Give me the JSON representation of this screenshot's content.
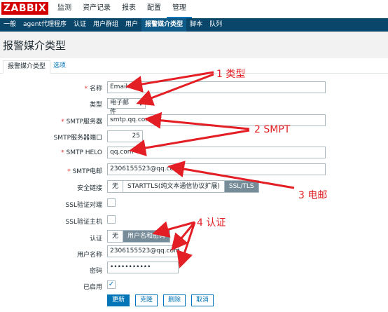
{
  "logo": "ZABBIX",
  "top_menu": [
    "监测",
    "资产记录",
    "报表",
    "配置",
    "管理"
  ],
  "sub_menu": [
    "一般",
    "agent代理程序",
    "认证",
    "用户群组",
    "用户",
    "报警媒介类型",
    "脚本",
    "队列"
  ],
  "page_title": "报警媒介类型",
  "tabs": {
    "active": "报警媒介类型",
    "other": "选项"
  },
  "form": {
    "name_label": "名称",
    "name_value": "Email",
    "type_label": "类型",
    "type_value": "电子邮件",
    "smtp_server_label": "SMTP服务器",
    "smtp_server_value": "smtp.qq.com",
    "smtp_port_label": "SMTP服务器端口",
    "smtp_port_value": "25",
    "smtp_helo_label": "SMTP HELO",
    "smtp_helo_value": "qq.com",
    "smtp_email_label": "SMTP电邮",
    "smtp_email_value": "2306155523@qq.com",
    "security_label": "安全链接",
    "security_options": [
      "无",
      "STARTTLS(纯文本通信协议扩展)",
      "SSL/TLS"
    ],
    "ssl_peer_label": "SSL验证对端",
    "ssl_host_label": "SSL验证主机",
    "auth_label": "认证",
    "auth_options": [
      "无",
      "用户名和密码"
    ],
    "username_label": "用户名称",
    "username_value": "2306155523@qq.com",
    "password_label": "密码",
    "password_value": "•••••••••••",
    "enabled_label": "已启用"
  },
  "buttons": {
    "update": "更新",
    "clone": "克隆",
    "delete": "删除",
    "cancel": "取消"
  },
  "annotations": [
    "1 类型",
    "2 SMPT",
    "3 电邮",
    "4 认证"
  ],
  "colors": {
    "accent": "#0275b8",
    "nav": "#0a466a",
    "annotation": "#e31e24",
    "logo": "#d40000"
  }
}
